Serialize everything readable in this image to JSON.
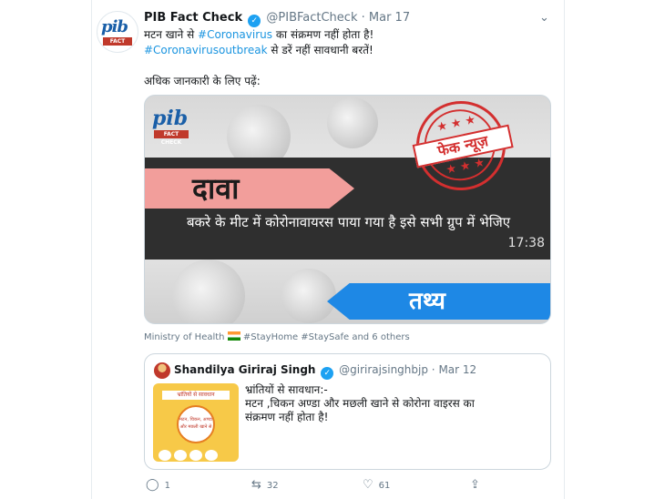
{
  "tweet": {
    "name": "PIB Fact Check",
    "handle": "@PIBFactCheck",
    "date": "Mar 17",
    "line1_text": "मटन खाने से ",
    "line1_hashtag": "#Coronavirus",
    "line1_rest": " का संक्रमण नहीं होता है!",
    "line2_hashtag": "#Coronavirusoutbreak",
    "line2_rest": " से डरें नहीं सावधानी बरतें!",
    "line3": "अधिक जानकारी के लिए पढ़ें:"
  },
  "logo": {
    "mark": "pib",
    "sub": "FACT CHECK"
  },
  "media": {
    "claim_label": "दावा",
    "claim_text": "बकरे के मीट में कोरोनावायरस पाया गया है इसे सभी ग्रुप में भेजिए",
    "time": "17:38",
    "stamp": "फेक न्यूज़",
    "fact_label": "तथ्य",
    "stars_top": "★ ★ ★",
    "stars_bottom": "★ ★ ★"
  },
  "tags": {
    "org": "Ministry of Health",
    "rest": "#StayHome #StaySafe and 6 others"
  },
  "quoted": {
    "name": "Shandilya Giriraj Singh",
    "handle": "@girirajsinghbjp",
    "date": "Mar 12",
    "line1": "भ्रांतियों से सावधान:-",
    "line2": "मटन ,चिकन अण्डा और मछली खाने से कोरोना वाइरस का",
    "line3": "संक्रमण नहीं होता है!",
    "img_title": "भ्रांतियों से सावधान",
    "img_text": "मटन, चिकन, अण्डा और मछली खाने से"
  },
  "actions": {
    "reply_count": "1",
    "retweet_count": "32",
    "like_count": "61"
  },
  "icons": [
    "verified-icon",
    "chevron-down-icon",
    "reply-icon",
    "retweet-icon",
    "like-icon",
    "share-icon",
    "india-flag-icon"
  ],
  "colors": {
    "link": "#1b95e0",
    "verified": "#1da1f2",
    "stamp": "#d32f2f",
    "fact_band": "#1e88e5",
    "claim_band": "#f29e9b"
  }
}
